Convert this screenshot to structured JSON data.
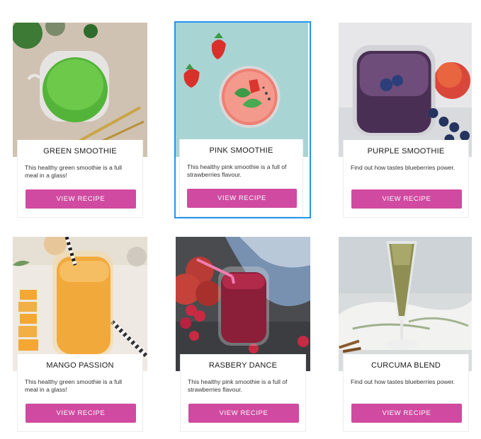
{
  "cards": [
    {
      "title": "GREEN SMOOTHIE",
      "description": "This healthy green smoothie is a full meal in a glass!",
      "button_label": "VIEW RECIPE",
      "image": "green-smoothie-image"
    },
    {
      "title": "PINK SMOOTHIE",
      "description": "This healthy pink smoothie is a full of strawberries flavour.",
      "button_label": "VIEW RECIPE",
      "image": "pink-smoothie-image",
      "selected": true
    },
    {
      "title": "PURPLE SMOOTHIE",
      "description": "Find out how tastes blueberries power.",
      "button_label": "VIEW RECIPE",
      "image": "purple-smoothie-image"
    },
    {
      "title": "MANGO PASSION",
      "description": "This healthy green smoothie is a full meal in a glass!",
      "button_label": "VIEW RECIPE",
      "image": "mango-smoothie-image"
    },
    {
      "title": "RASBERY DANCE",
      "description": "This healthy pink smoothie is a full of strawberries flavour.",
      "button_label": "VIEW RECIPE",
      "image": "raspberry-smoothie-image"
    },
    {
      "title": "CURCUMA BLEND",
      "description": "Find out how tastes blueberries power.",
      "button_label": "VIEW RECIPE",
      "image": "curcuma-smoothie-image"
    }
  ],
  "colors": {
    "button": "#cf4aa0",
    "selection_border": "#2196f3"
  }
}
